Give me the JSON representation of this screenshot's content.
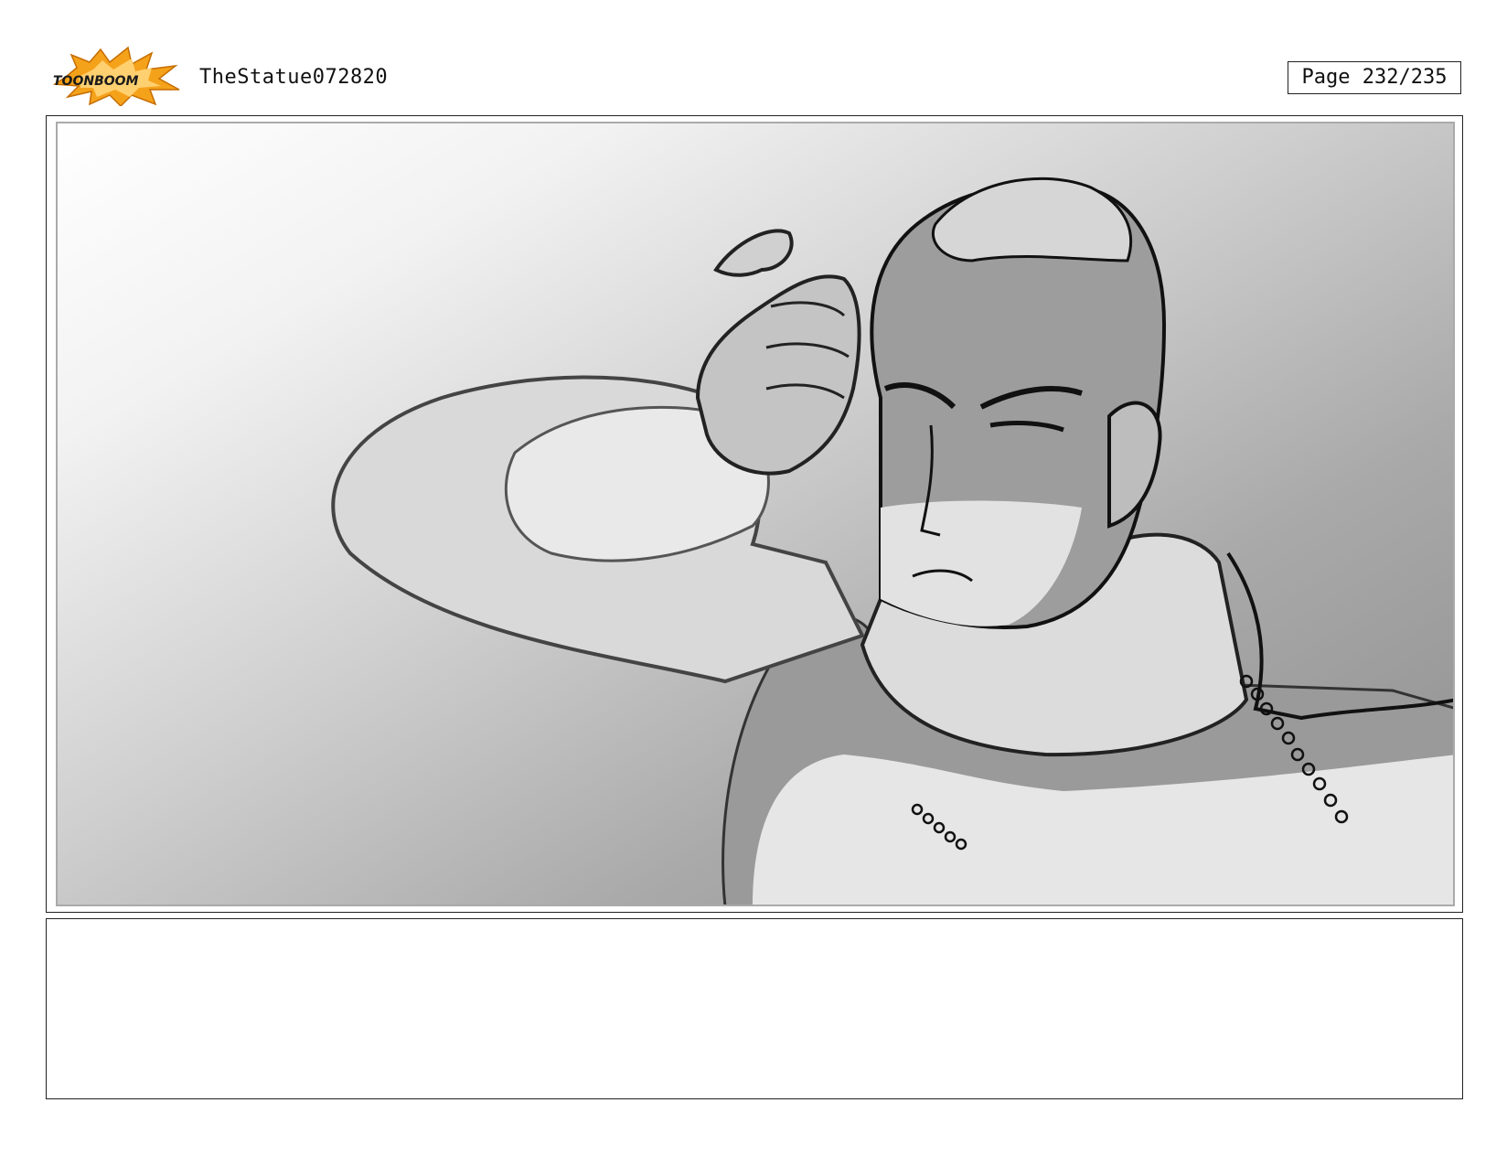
{
  "header": {
    "logo_text": "TOONBOOM",
    "project_title": "TheStatue072820",
    "page_label": "Page 232/235"
  },
  "colors": {
    "logo_burst": "#f5a21b",
    "logo_text": "#1a1a1a",
    "frame_border": "#222222",
    "panel_inner_border": "#aaaaaa"
  },
  "panel": {
    "type": "storyboard-drawing",
    "drawing": "sketch-character-turtleneck-hand-raised"
  },
  "notes": {
    "text": ""
  }
}
